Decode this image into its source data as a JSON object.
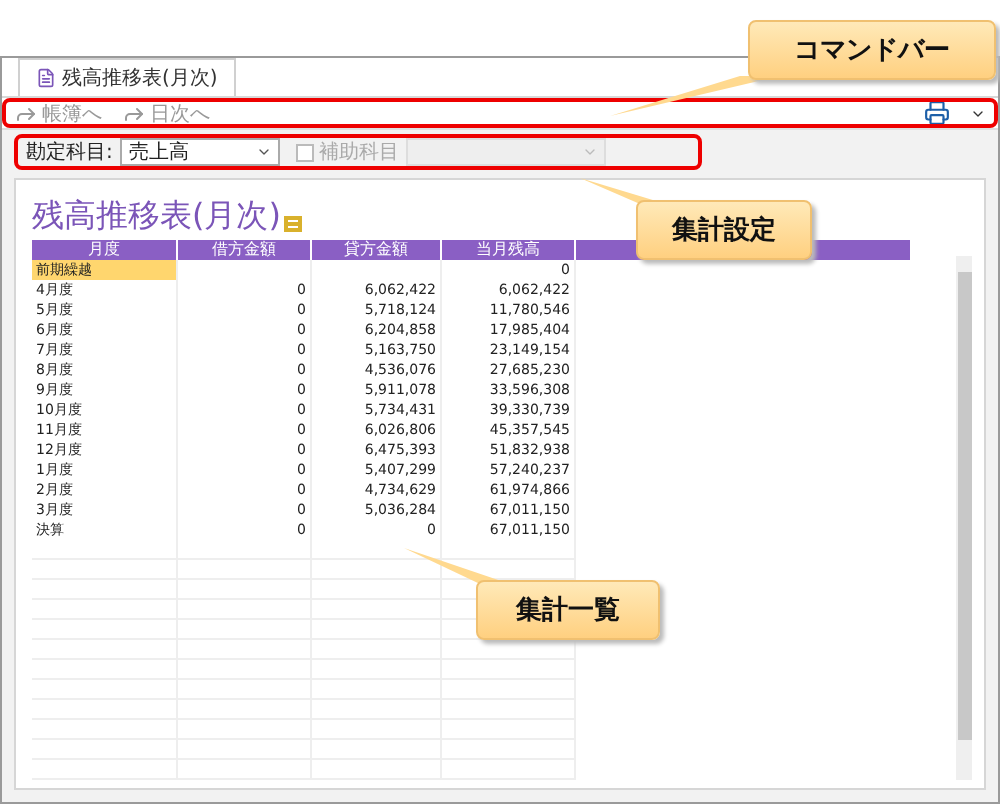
{
  "tab": {
    "label": "残高推移表(月次)",
    "selected": true
  },
  "command_bar": {
    "buttons": [
      "帳簿へ",
      "日次へ"
    ]
  },
  "settings": {
    "account_label": "勘定科目:",
    "account_value": "売上高",
    "sub_account": {
      "label": "補助科目",
      "checked": false,
      "disabled": true
    }
  },
  "report": {
    "title": "残高推移表(月次)",
    "columns": [
      "月度",
      "借方金額",
      "貸方金額",
      "当月残高"
    ],
    "rows": [
      {
        "month": "前期繰越",
        "balance": "0",
        "selected": true
      },
      {
        "month": "4月度",
        "debit": "0",
        "credit": "6,062,422",
        "balance": "6,062,422",
        "selected": false
      },
      {
        "month": "5月度",
        "debit": "0",
        "credit": "5,718,124",
        "balance": "11,780,546",
        "selected": false
      },
      {
        "month": "6月度",
        "debit": "0",
        "credit": "6,204,858",
        "balance": "17,985,404",
        "selected": false
      },
      {
        "month": "7月度",
        "debit": "0",
        "credit": "5,163,750",
        "balance": "23,149,154",
        "selected": false
      },
      {
        "month": "8月度",
        "debit": "0",
        "credit": "4,536,076",
        "balance": "27,685,230",
        "selected": false
      },
      {
        "month": "9月度",
        "debit": "0",
        "credit": "5,911,078",
        "balance": "33,596,308",
        "selected": false
      },
      {
        "month": "10月度",
        "debit": "0",
        "credit": "5,734,431",
        "balance": "39,330,739",
        "selected": false
      },
      {
        "month": "11月度",
        "debit": "0",
        "credit": "6,026,806",
        "balance": "45,357,545",
        "selected": false
      },
      {
        "month": "12月度",
        "debit": "0",
        "credit": "6,475,393",
        "balance": "51,832,938",
        "selected": false
      },
      {
        "month": "1月度",
        "debit": "0",
        "credit": "5,407,299",
        "balance": "57,240,237",
        "selected": false
      },
      {
        "month": "2月度",
        "debit": "0",
        "credit": "4,734,629",
        "balance": "61,974,866",
        "selected": false
      },
      {
        "month": "3月度",
        "debit": "0",
        "credit": "5,036,284",
        "balance": "67,011,150",
        "selected": false
      },
      {
        "month": "決算",
        "debit": "0",
        "credit": "0",
        "balance": "67,011,150",
        "selected": false
      }
    ]
  },
  "callouts": [
    "コマンドバー",
    "集計設定",
    "集計一覧"
  ]
}
